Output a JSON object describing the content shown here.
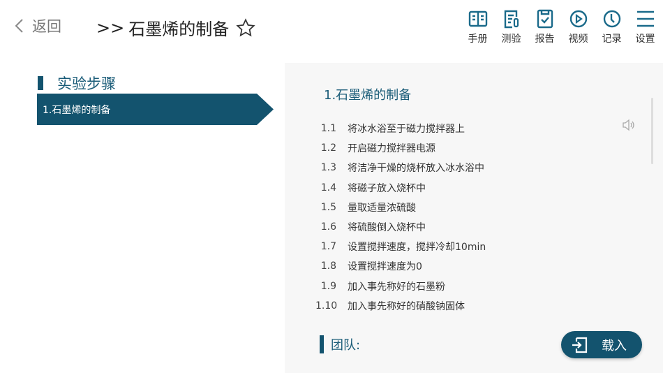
{
  "header": {
    "back_label": "返回",
    "title": "石墨烯的制备",
    "title_prefix": ">>"
  },
  "toolbar": [
    {
      "label": "手册",
      "icon": "book-icon"
    },
    {
      "label": "测验",
      "icon": "quiz-icon"
    },
    {
      "label": "报告",
      "icon": "report-icon"
    },
    {
      "label": "视频",
      "icon": "video-icon"
    },
    {
      "label": "记录",
      "icon": "clock-icon"
    },
    {
      "label": "设置",
      "icon": "menu-icon"
    }
  ],
  "sidebar": {
    "heading": "实验步骤",
    "steps": [
      "1.石墨烯的制备"
    ]
  },
  "panel": {
    "heading": "1.石墨烯的制备",
    "steps": [
      {
        "n": "1.1",
        "t": "将冰水浴至于磁力搅拌器上"
      },
      {
        "n": "1.2",
        "t": "开启磁力搅拌器电源"
      },
      {
        "n": "1.3",
        "t": "将洁净干燥的烧杯放入冰水浴中"
      },
      {
        "n": "1.4",
        "t": "将磁子放入烧杯中"
      },
      {
        "n": "1.5",
        "t": "量取适量浓硫酸"
      },
      {
        "n": "1.6",
        "t": "将硫酸倒入烧杯中"
      },
      {
        "n": "1.7",
        "t": "设置搅拌速度，搅拌冷却10min"
      },
      {
        "n": "1.8",
        "t": "设置搅拌速度为0"
      },
      {
        "n": "1.9",
        "t": "加入事先称好的石墨粉"
      },
      {
        "n": "1.10",
        "t": "加入事先称好的硝酸钠固体"
      }
    ],
    "team_label": "团队:",
    "load_label": "载入"
  },
  "colors": {
    "accent": "#13536e"
  }
}
